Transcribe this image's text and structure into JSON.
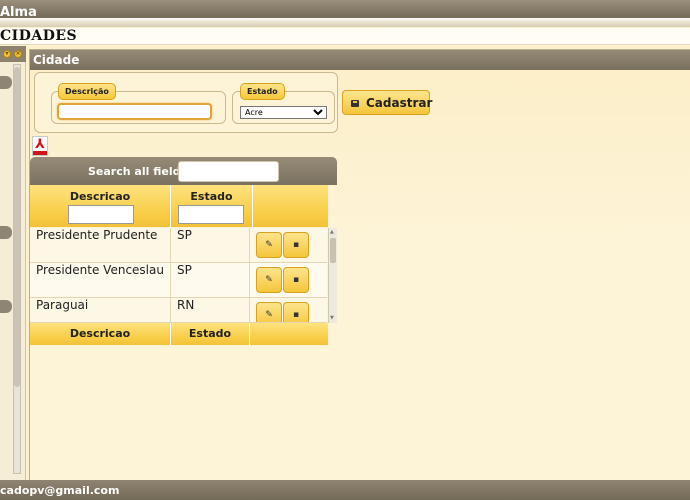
{
  "app": {
    "title": "Alma"
  },
  "page": {
    "heading": "CIDADES",
    "footer_email": "cadopv@gmail.com"
  },
  "window": {
    "title": "Cidade"
  },
  "form": {
    "descricao": {
      "legend": "Descrição",
      "value": ""
    },
    "estado": {
      "legend": "Estado",
      "selected": "Acre"
    },
    "submit_label": "Cadastrar"
  },
  "grid": {
    "search_label": "Search all fields:",
    "search_value": "",
    "columns": [
      "Descricao",
      "Estado"
    ],
    "rows": [
      {
        "descricao": "Presidente Prudente",
        "estado": "SP"
      },
      {
        "descricao": "Presidente Venceslau",
        "estado": "SP"
      },
      {
        "descricao": "Paraguai",
        "estado": "RN"
      }
    ],
    "footer_columns": [
      "Descricao",
      "Estado"
    ]
  },
  "icons": {
    "save": "save-icon",
    "edit": "pencil-icon",
    "delete": "trash-icon",
    "pdf": "pdf-icon"
  },
  "colors": {
    "accent_yellow": "#f4c53b",
    "titlebar": "#7c715f",
    "background": "#fdf0cc"
  }
}
